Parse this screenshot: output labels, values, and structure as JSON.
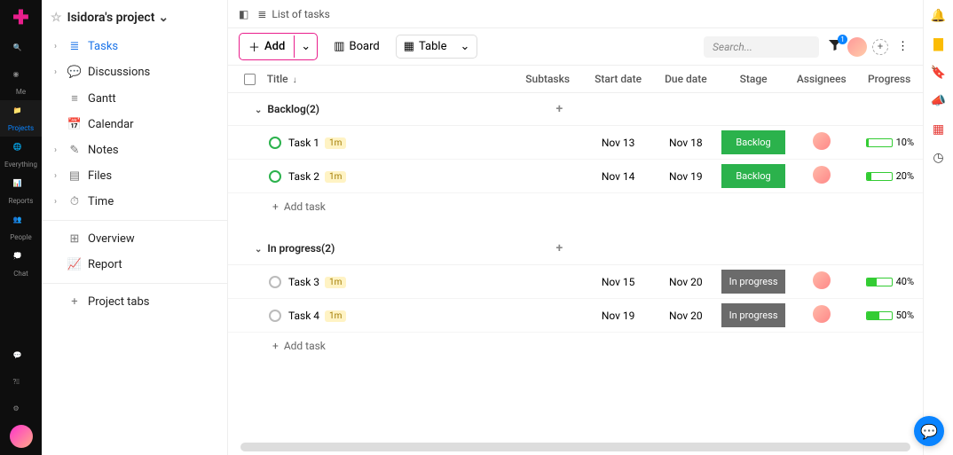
{
  "rail": {
    "items": [
      {
        "icon": "search",
        "label": ""
      },
      {
        "icon": "user",
        "label": "Me"
      },
      {
        "icon": "folder",
        "label": "Projects",
        "active": true
      },
      {
        "icon": "globe",
        "label": "Everything"
      },
      {
        "icon": "chart",
        "label": "Reports"
      },
      {
        "icon": "people",
        "label": "People"
      },
      {
        "icon": "chat",
        "label": "Chat"
      }
    ]
  },
  "project": {
    "title": "Isidora's project"
  },
  "sidebar": {
    "items": [
      {
        "label": "Tasks",
        "icon": "list",
        "caret": true,
        "active": true
      },
      {
        "label": "Discussions",
        "icon": "chat",
        "caret": true
      },
      {
        "label": "Gantt",
        "icon": "gantt"
      },
      {
        "label": "Calendar",
        "icon": "calendar"
      },
      {
        "label": "Notes",
        "icon": "note",
        "caret": true
      },
      {
        "label": "Files",
        "icon": "file",
        "caret": true
      },
      {
        "label": "Time",
        "icon": "clock",
        "caret": true
      }
    ],
    "secondary": [
      {
        "label": "Overview",
        "icon": "overview"
      },
      {
        "label": "Report",
        "icon": "report"
      }
    ],
    "tertiary": [
      {
        "label": "Project tabs",
        "icon": "plus"
      }
    ]
  },
  "topbar": {
    "breadcrumb": "List of tasks"
  },
  "toolbar": {
    "add_label": "Add",
    "board_label": "Board",
    "table_label": "Table",
    "search_placeholder": "Search...",
    "filter_count": "1"
  },
  "columns": {
    "title": "Title",
    "subtasks": "Subtasks",
    "start": "Start date",
    "due": "Due date",
    "stage": "Stage",
    "assignees": "Assignees",
    "progress": "Progress"
  },
  "groups": [
    {
      "name": "Backlog",
      "count": 2,
      "stage_class": "backlog",
      "circle_class": "",
      "tasks": [
        {
          "name": "Task 1",
          "badge": "1m",
          "start": "Nov 13",
          "due": "Nov 18",
          "stage": "Backlog",
          "progress": 10
        },
        {
          "name": "Task 2",
          "badge": "1m",
          "start": "Nov 14",
          "due": "Nov 19",
          "stage": "Backlog",
          "progress": 20
        }
      ]
    },
    {
      "name": "In progress",
      "count": 2,
      "stage_class": "inprogress",
      "circle_class": "gray",
      "tasks": [
        {
          "name": "Task 3",
          "badge": "1m",
          "start": "Nov 15",
          "due": "Nov 20",
          "stage": "In progress",
          "progress": 40
        },
        {
          "name": "Task 4",
          "badge": "1m",
          "start": "Nov 19",
          "due": "Nov 20",
          "stage": "In progress",
          "progress": 50
        }
      ]
    }
  ],
  "add_task_label": "Add task"
}
